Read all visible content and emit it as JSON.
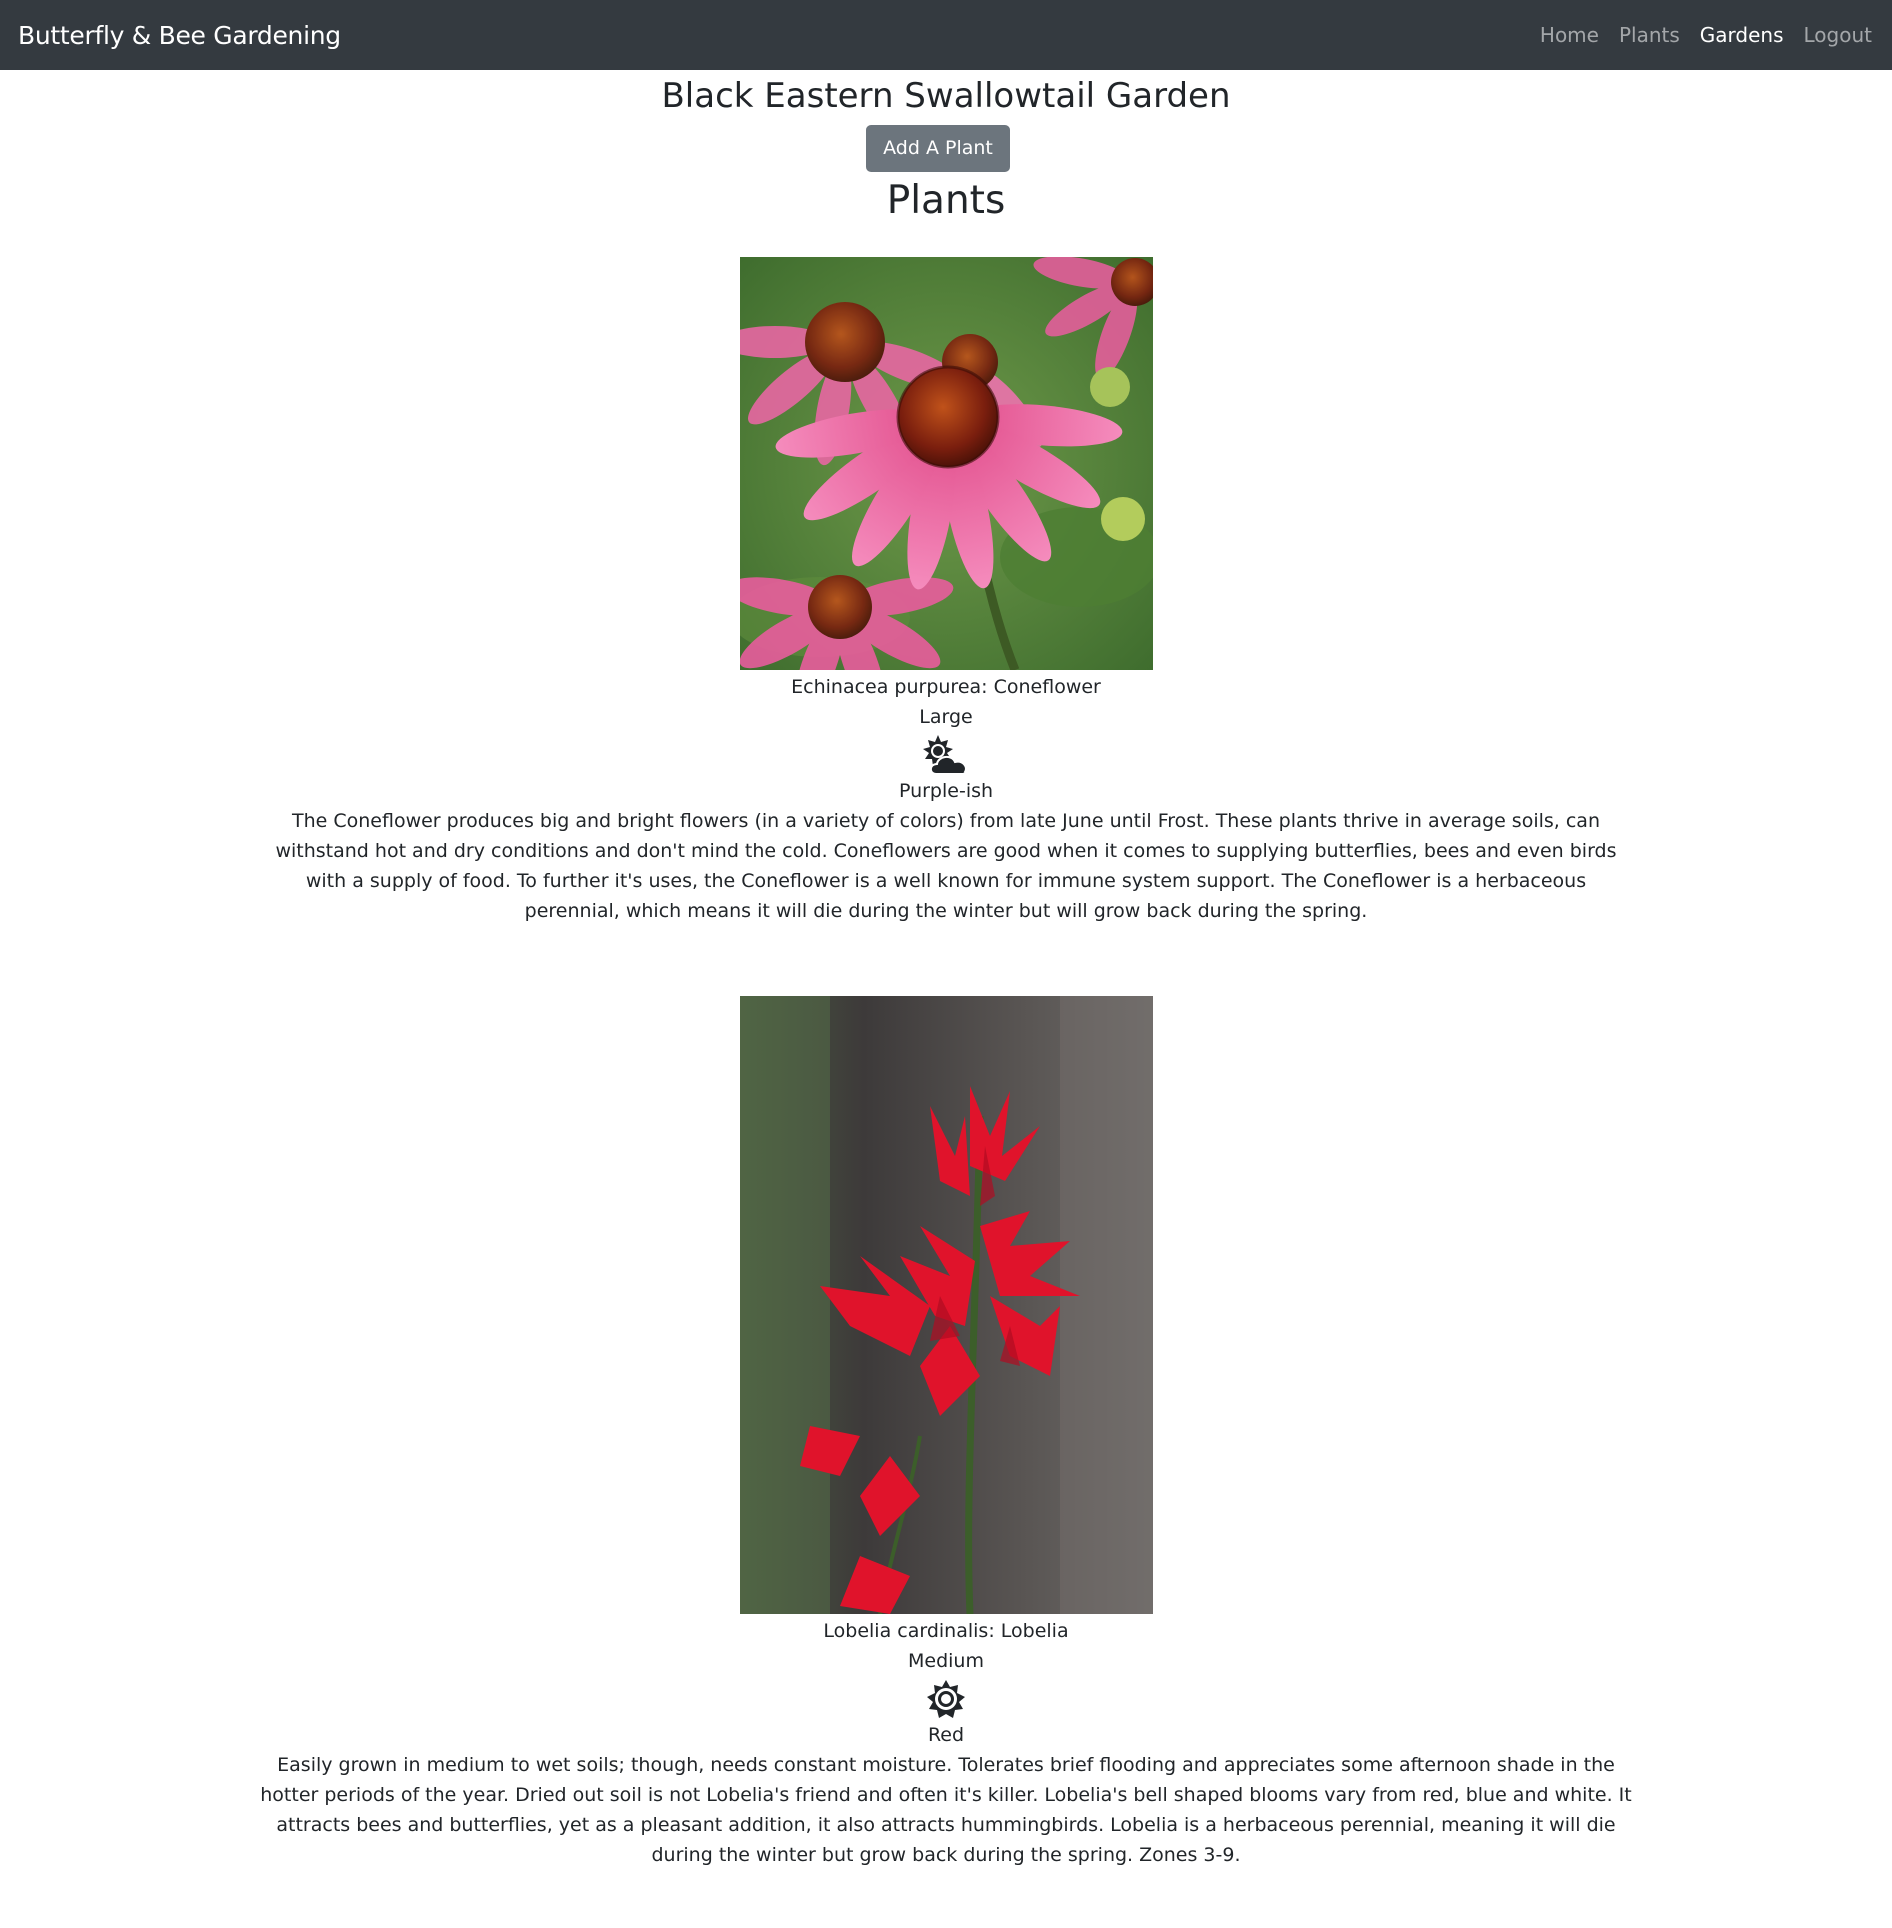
{
  "navbar": {
    "brand": "Butterfly & Bee Gardening",
    "links": [
      {
        "label": "Home",
        "active": false
      },
      {
        "label": "Plants",
        "active": false
      },
      {
        "label": "Gardens",
        "active": true
      },
      {
        "label": "Logout",
        "active": false
      }
    ]
  },
  "garden": {
    "title": "Black Eastern Swallowtail Garden",
    "add_button": "Add A Plant",
    "plants_heading": "Plants"
  },
  "plants": [
    {
      "name": "Echinacea purpurea: Coneflower",
      "size": "Large",
      "sun_icon": "partial-sun-cloud-icon",
      "color": "Purple-ish",
      "description": "The Coneflower produces big and bright flowers (in a variety of colors) from late June until Frost. These plants thrive in average soils, can withstand hot and dry conditions and don't mind the cold. Coneflowers are good when it comes to supplying butterflies, bees and even birds with a supply of food. To further it's uses, the Coneflower is a well known for immune system support. The Coneflower is a herbaceous perennial, which means it will die during the winter but will grow back during the spring."
    },
    {
      "name": "Lobelia cardinalis: Lobelia",
      "size": "Medium",
      "sun_icon": "full-sun-icon",
      "color": "Red",
      "description": "Easily grown in medium to wet soils; though, needs constant moisture. Tolerates brief flooding and appreciates some afternoon shade in the hotter periods of the year. Dried out soil is not Lobelia's friend and often it's killer. Lobelia's bell shaped blooms vary from red, blue and white. It attracts bees and butterflies, yet as a pleasant addition, it also attracts hummingbirds. Lobelia is a herbaceous perennial, meaning it will die during the winter but grow back during the spring. Zones 3-9."
    }
  ]
}
